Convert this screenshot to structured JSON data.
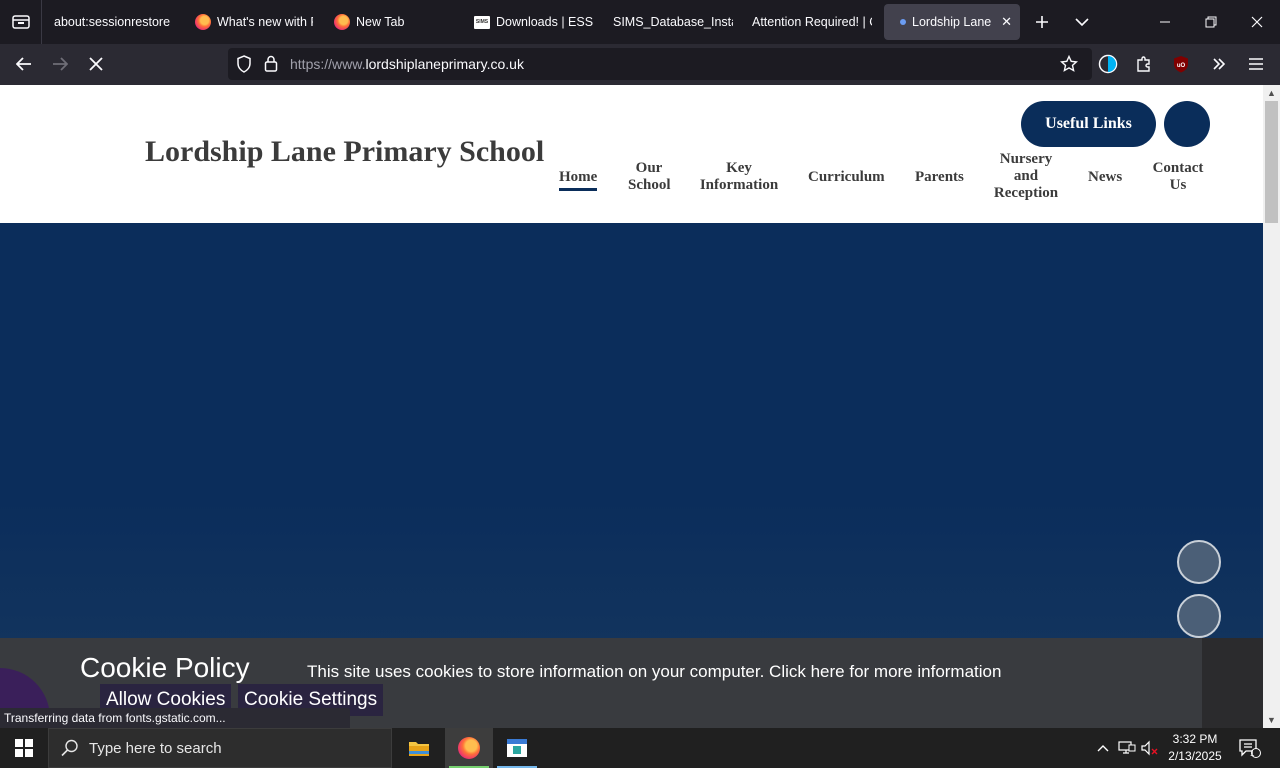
{
  "browser": {
    "tabs": [
      {
        "title": "about:sessionrestore",
        "favicon": "none"
      },
      {
        "title": "What's new with F",
        "favicon": "firefox-icon"
      },
      {
        "title": "New Tab",
        "favicon": "firefox-icon"
      },
      {
        "title": "Downloads | ESS S",
        "favicon": "sims-icon"
      },
      {
        "title": "SIMS_Database_Install",
        "favicon": "none"
      },
      {
        "title": "Attention Required! | C",
        "favicon": "none"
      },
      {
        "title": "Lordship Lane P",
        "favicon": "loading-dot-icon",
        "active": true
      }
    ],
    "url_prefix": "https://www.",
    "url_domain": "lordshiplaneprimary.co.uk",
    "status_text": "Transferring data from fonts.gstatic.com..."
  },
  "site": {
    "school_name": "Lordship Lane Primary School",
    "useful_links_label": "Useful Links",
    "menu": [
      {
        "label": "Home",
        "active": true
      },
      {
        "label": "Our School"
      },
      {
        "label": "Key Information"
      },
      {
        "label": "Curriculum"
      },
      {
        "label": "Parents"
      },
      {
        "label": "Nursery and Reception"
      },
      {
        "label": "News"
      },
      {
        "label": "Contact Us"
      }
    ],
    "brand_color": "#0a2d5a",
    "cookie": {
      "title": "Cookie Policy",
      "text": "This site uses cookies to store information on your computer. Click here for more information",
      "allow_label": "Allow Cookies",
      "settings_label": "Cookie Settings"
    }
  },
  "taskbar": {
    "search_placeholder": "Type here to search",
    "time": "3:32 PM",
    "date": "2/13/2025",
    "notification_count": "1"
  }
}
